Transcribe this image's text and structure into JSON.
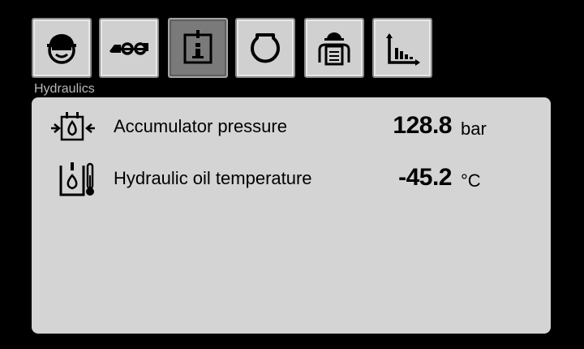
{
  "tabs": [
    {
      "icon": "hard-hat-face-icon"
    },
    {
      "icon": "loader-vehicle-icon"
    },
    {
      "icon": "info-document-icon",
      "active": true
    },
    {
      "icon": "engine-icon"
    },
    {
      "icon": "operator-report-icon"
    },
    {
      "icon": "bar-chart-icon"
    }
  ],
  "section": {
    "title": "Hydraulics"
  },
  "readings": [
    {
      "icon": "accumulator-pressure-icon",
      "label": "Accumulator pressure",
      "value": "128.8",
      "unit": "bar"
    },
    {
      "icon": "oil-temperature-icon",
      "label": "Hydraulic oil temperature",
      "value": "-45.2",
      "unit": "°C"
    }
  ]
}
